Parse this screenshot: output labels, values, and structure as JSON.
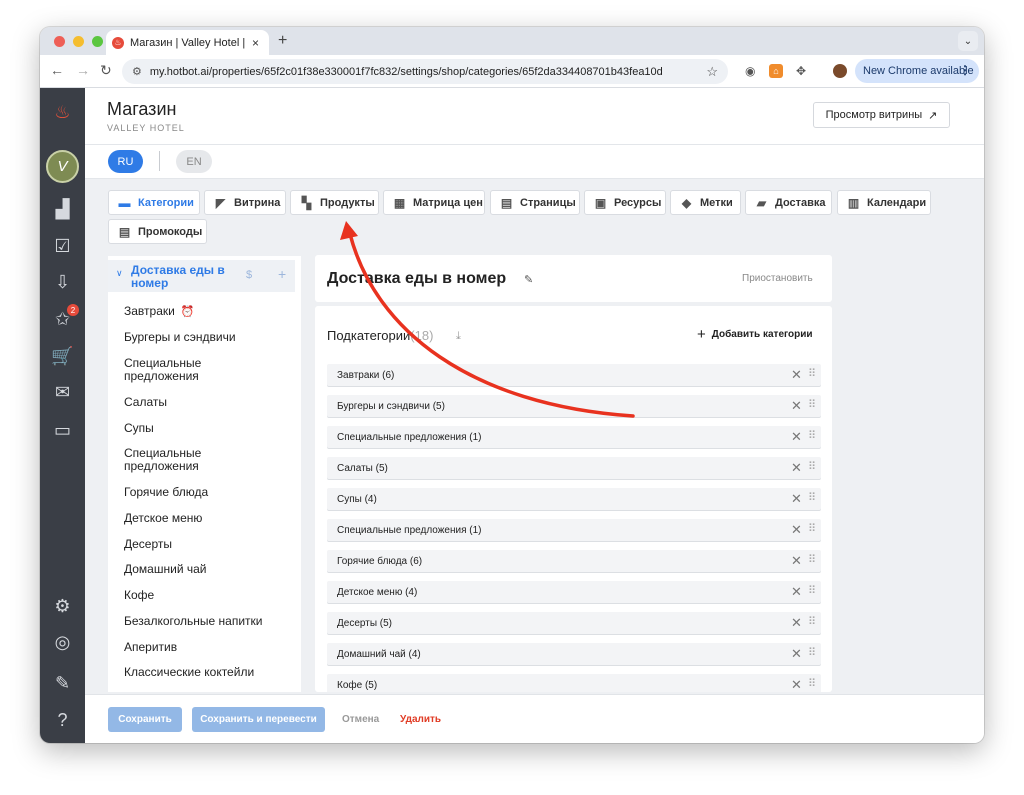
{
  "browser": {
    "tab_title": "Магазин | Valley Hotel | Hotb",
    "url": "my.hotbot.ai/properties/65f2c01f38e330001f7fc832/settings/shop/categories/65f2da334408701b43fea10d",
    "update_label": "New Chrome available",
    "traffic_colors": [
      "#ee5f57",
      "#f5bd2f",
      "#5bc640"
    ]
  },
  "header": {
    "title": "Магазин",
    "subtitle": "VALLEY HOTEL",
    "preview_label": "Просмотр витрины",
    "preview_icon": "↗"
  },
  "languages": {
    "ru": "RU",
    "en": "EN"
  },
  "tabs": [
    {
      "label": "Категории",
      "icon": "storefront-icon",
      "glyph": "▬",
      "active": true
    },
    {
      "label": "Витрина",
      "icon": "showcase-icon",
      "glyph": "◤"
    },
    {
      "label": "Продукты",
      "icon": "products-icon",
      "glyph": "▚"
    },
    {
      "label": "Матрица цен",
      "icon": "price-matrix-icon",
      "glyph": "▦"
    },
    {
      "label": "Страницы",
      "icon": "pages-icon",
      "glyph": "▤"
    },
    {
      "label": "Ресурсы",
      "icon": "resources-icon",
      "glyph": "▣"
    },
    {
      "label": "Метки",
      "icon": "tag-icon",
      "glyph": "◆"
    },
    {
      "label": "Доставка",
      "icon": "truck-icon",
      "glyph": "▰"
    },
    {
      "label": "Календари",
      "icon": "calendar-icon",
      "glyph": "▥"
    },
    {
      "label": "Промокоды",
      "icon": "promo-icon",
      "glyph": "▤"
    }
  ],
  "tree": {
    "root_label": "Доставка еды в номер",
    "items": [
      "Завтраки",
      "Бургеры и сэндвичи",
      "Специальные предложения",
      "Салаты",
      "Супы",
      "Специальные предложения",
      "Горячие блюда",
      "Детское меню",
      "Десерты",
      "Домашний чай",
      "Кофе",
      "Безалкогольные напитки",
      "Аперитив",
      "Классические коктейли"
    ]
  },
  "main": {
    "title": "Доставка еды в номер",
    "suspend_label": "Приостановить",
    "sub_title": "Подкатегории",
    "sub_count": "(18)",
    "add_label": "Добавить категории",
    "rows": [
      "Завтраки (6)",
      "Бургеры и сэндвичи (5)",
      "Специальные предложения (1)",
      "Салаты (5)",
      "Супы (4)",
      "Специальные предложения (1)",
      "Горячие блюда (6)",
      "Детское меню (4)",
      "Десерты (5)",
      "Домашний чай (4)",
      "Кофе (5)"
    ]
  },
  "sidebar": {
    "notification_count": "2",
    "avatar_letter": "V"
  },
  "footer": {
    "save_label": "Сохранить",
    "save_translate_label": "Сохранить и перевести",
    "cancel_label": "Отмена",
    "delete_label": "Удалить"
  },
  "annotation": {
    "arrow_color": "#e8321f"
  }
}
